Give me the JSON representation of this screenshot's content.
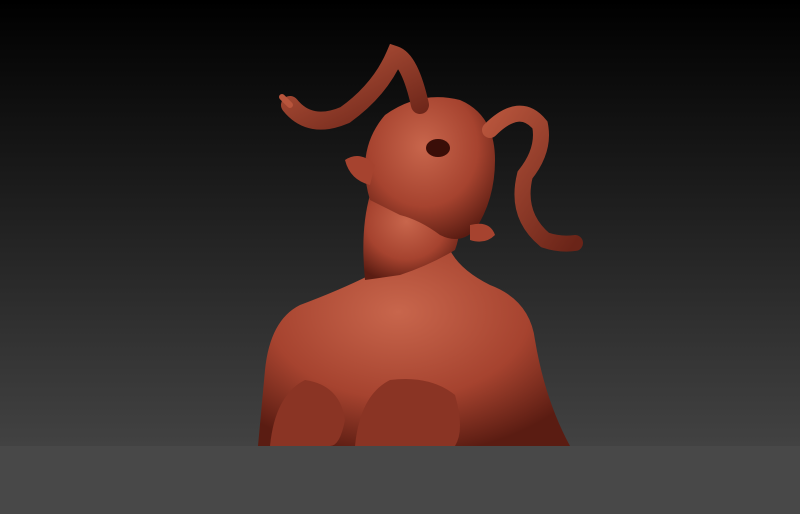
{
  "scene": {
    "subject": "sculpted-demon-bust",
    "colors": {
      "background_top": "#000000",
      "background_bottom": "#4c4c4c",
      "floor": "#484848",
      "clay_base": "#a6432f",
      "clay_highlight": "#c8664c",
      "clay_shadow": "#5a1c12"
    }
  }
}
